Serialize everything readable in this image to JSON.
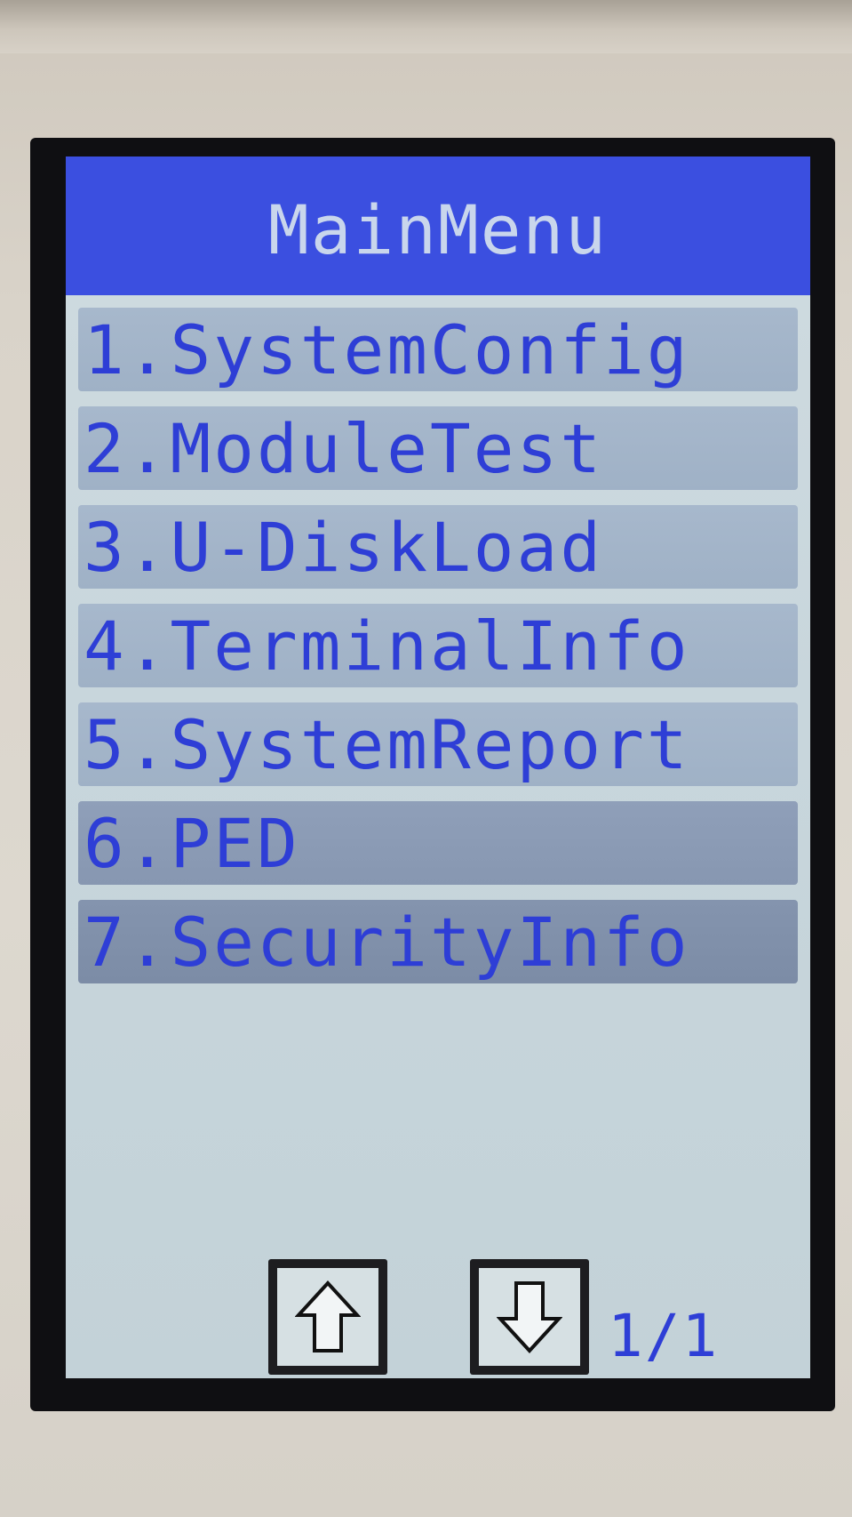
{
  "screen": {
    "title": "MainMenu"
  },
  "menu": {
    "items": [
      {
        "label": "1.SystemConfig"
      },
      {
        "label": "2.ModuleTest"
      },
      {
        "label": "3.U-DiskLoad"
      },
      {
        "label": "4.TerminalInfo"
      },
      {
        "label": "5.SystemReport"
      },
      {
        "label": "6.PED"
      },
      {
        "label": "7.SecurityInfo"
      }
    ]
  },
  "pager": {
    "up_icon": "arrow-up-icon",
    "down_icon": "arrow-down-icon",
    "page_indicator": "1/1"
  },
  "colors": {
    "title_bar": "#3b4fe0",
    "title_text": "#c9d6ec",
    "menu_text": "#2e3ed6",
    "menu_item_bg": "#a7b8cc",
    "screen_bg": "#cfdbe0",
    "bezel": "#0f0f12"
  }
}
